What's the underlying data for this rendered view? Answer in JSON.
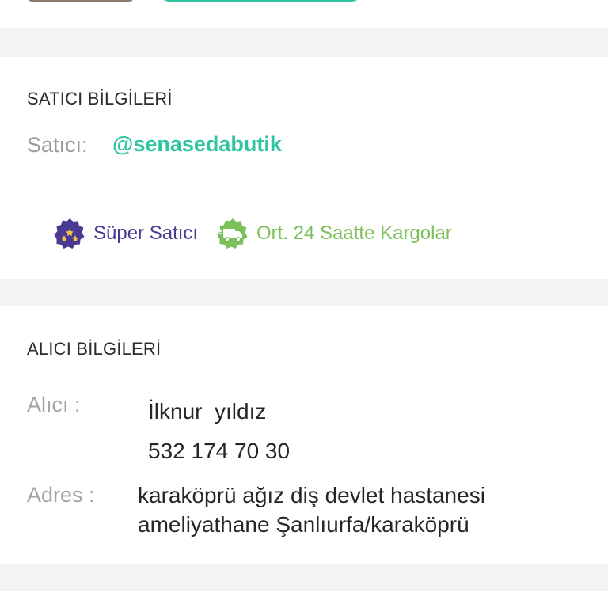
{
  "seller_section": {
    "title": "SATICI BİLGİLERİ",
    "seller_label": "Satıcı:",
    "seller_handle": "@senasedabutik",
    "badges": [
      {
        "label": "Süper Satıcı",
        "icon": "star-medal-icon",
        "color": "#4a3a93"
      },
      {
        "label": "Ort. 24 Saatte Kargolar",
        "icon": "delivery-truck-icon",
        "color": "#7bc05a"
      }
    ]
  },
  "buyer_section": {
    "title": "ALICI BİLGİLERİ",
    "buyer_label": "Alıcı :",
    "buyer_name": "İlknur  yıldız",
    "buyer_phone": "532 174 70 30",
    "address_label": "Adres :",
    "address_line1": "karaköprü ağız diş devlet hastanesi",
    "address_line2": "ameliyathane Şanlıurfa/karaköprü"
  },
  "colors": {
    "accent": "#2ec4a0",
    "background": "#f3f3f3",
    "card": "#ffffff"
  }
}
